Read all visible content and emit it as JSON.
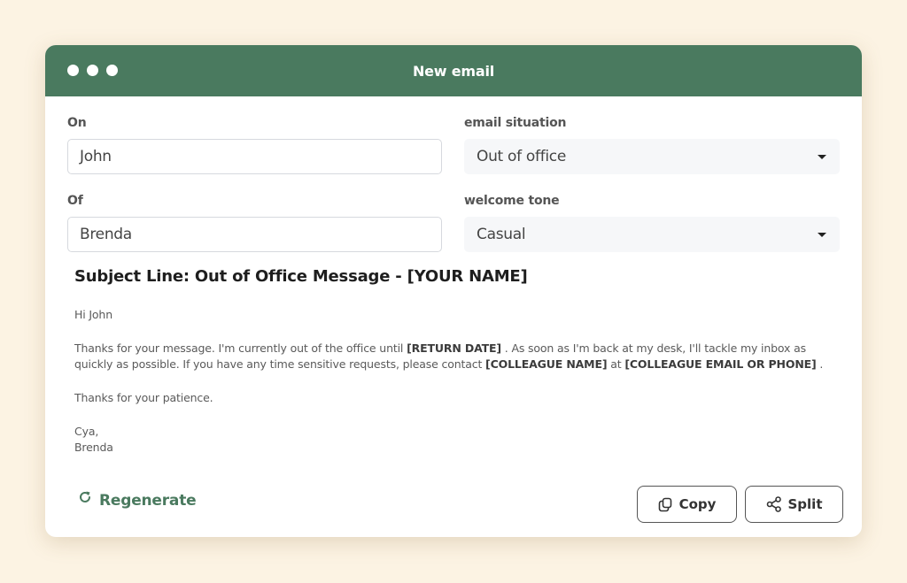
{
  "window": {
    "title": "New email"
  },
  "form": {
    "to": {
      "label": "On",
      "value": "John"
    },
    "from": {
      "label": "Of",
      "value": "Brenda"
    },
    "situation": {
      "label": "email situation",
      "selected": "Out of office"
    },
    "tone": {
      "label": "welcome tone",
      "selected": "Casual"
    }
  },
  "email": {
    "subject": "Subject Line: Out of Office Message - [YOUR NAME]",
    "greeting": "Hi John",
    "paragraph": {
      "t1": "Thanks for your message. I'm currently out of the office until ",
      "b1": "[RETURN DATE]",
      "t2": " . As soon as I'm back at my desk, I'll tackle my inbox as quickly as possible. If you have any time sensitive requests, please contact ",
      "b2": "[COLLEAGUE NAME]",
      "t3": " at ",
      "b3": "[COLLEAGUE EMAIL OR PHONE]",
      "t4": " ."
    },
    "closing_line": "Thanks for your patience.",
    "signoff": "Cya,",
    "signature": "Brenda"
  },
  "actions": {
    "regenerate": {
      "label": "Regenerate",
      "icon": "refresh-icon"
    },
    "copy": {
      "label": "Copy",
      "icon": "copy-icon"
    },
    "split": {
      "label": "Split",
      "icon": "share-icon"
    }
  },
  "colors": {
    "accent": "#4a7a5f",
    "background": "#fcf3e3"
  }
}
